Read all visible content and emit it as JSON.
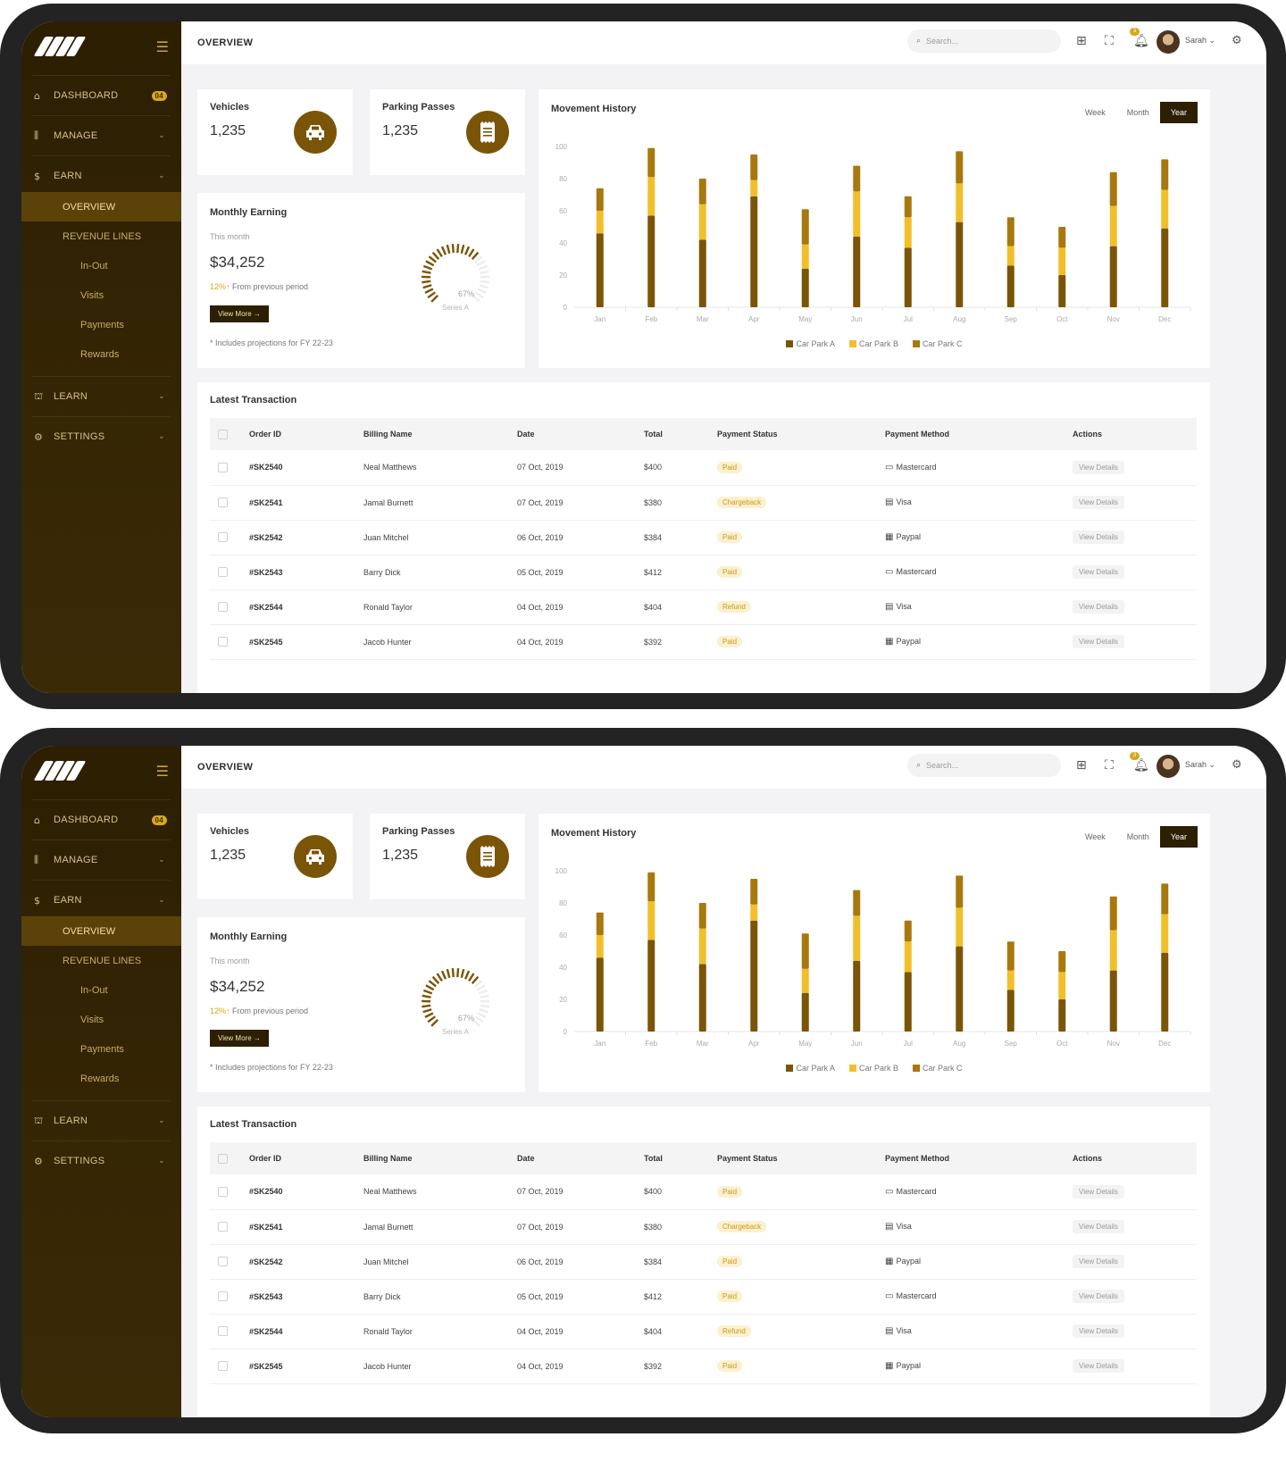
{
  "app": {
    "page_title": "OVERVIEW",
    "search_placeholder": "Search...",
    "user_name": "Sarah",
    "notification_count": "3"
  },
  "sidebar": {
    "dashboard": {
      "label": "DASHBOARD",
      "badge": "04"
    },
    "manage": {
      "label": "MANAGE"
    },
    "earn": {
      "label": "EARN"
    },
    "earn_items": [
      "OVERVIEW",
      "REVENUE LINES"
    ],
    "revenue_items": [
      "In-Out",
      "Visits",
      "Payments",
      "Rewards"
    ],
    "learn": {
      "label": "LEARN"
    },
    "settings": {
      "label": "SETTINGS"
    }
  },
  "stats": {
    "vehicles": {
      "label": "Vehicles",
      "value": "1,235"
    },
    "passes": {
      "label": "Parking Passes",
      "value": "1,235"
    }
  },
  "earning": {
    "title": "Monthly Earning",
    "period": "This month",
    "value": "$34,252",
    "change_pct": "12%",
    "change_arrow": "↑",
    "change_text": "From previous period",
    "button": "View More →",
    "note": "* Includes projections for FY 22-23",
    "gauge_pct": "67%",
    "gauge_series": "Series A",
    "gauge_value": 0.67
  },
  "movement": {
    "title": "Movement History",
    "ranges": [
      "Week",
      "Month",
      "Year"
    ],
    "active_range": "Year"
  },
  "chart_data": {
    "type": "bar",
    "stacked": true,
    "title": "Movement History",
    "categories": [
      "Jan",
      "Feb",
      "Mar",
      "Apr",
      "May",
      "Jun",
      "Jul",
      "Aug",
      "Sep",
      "Oct",
      "Nov",
      "Dec"
    ],
    "series": [
      {
        "name": "Car Park A",
        "color": "#7a5508",
        "values": [
          46,
          57,
          42,
          69,
          24,
          44,
          37,
          53,
          26,
          20,
          38,
          49
        ]
      },
      {
        "name": "Car Park B",
        "color": "#f2bf2a",
        "values": [
          14,
          24,
          22,
          10,
          15,
          28,
          19,
          24,
          12,
          17,
          25,
          24
        ]
      },
      {
        "name": "Car Park C",
        "color": "#a8780e",
        "values": [
          14,
          18,
          16,
          16,
          22,
          16,
          13,
          20,
          18,
          13,
          21,
          19
        ]
      }
    ],
    "yticks": [
      0,
      20,
      40,
      60,
      80,
      100
    ],
    "ylim": [
      0,
      100
    ],
    "legend": "bottom",
    "grid": false
  },
  "transactions": {
    "title": "Latest Transaction",
    "columns": [
      "Order ID",
      "Billing Name",
      "Date",
      "Total",
      "Payment Status",
      "Payment Method",
      "Actions"
    ],
    "action_label": "View Details",
    "rows": [
      {
        "id": "#SK2540",
        "name": "Neal Matthews",
        "date": "07 Oct, 2019",
        "total": "$400",
        "status": "Paid",
        "method": "Mastercard",
        "method_icon": "card"
      },
      {
        "id": "#SK2541",
        "name": "Jamal Burnett",
        "date": "07 Oct, 2019",
        "total": "$380",
        "status": "Chargeback",
        "method": "Visa",
        "method_icon": "visa"
      },
      {
        "id": "#SK2542",
        "name": "Juan Mitchel",
        "date": "06 Oct, 2019",
        "total": "$384",
        "status": "Paid",
        "method": "Paypal",
        "method_icon": "paypal"
      },
      {
        "id": "#SK2543",
        "name": "Barry Dick",
        "date": "05 Oct, 2019",
        "total": "$412",
        "status": "Paid",
        "method": "Mastercard",
        "method_icon": "card"
      },
      {
        "id": "#SK2544",
        "name": "Ronald Taylor",
        "date": "04 Oct, 2019",
        "total": "$404",
        "status": "Refund",
        "method": "Visa",
        "method_icon": "visa"
      },
      {
        "id": "#SK2545",
        "name": "Jacob Hunter",
        "date": "04 Oct, 2019",
        "total": "$392",
        "status": "Paid",
        "method": "Paypal",
        "method_icon": "paypal"
      }
    ]
  },
  "colors": {
    "sidebar": "#2c1f02",
    "accent": "#7a5508",
    "gold": "#f2bf2a",
    "bronze": "#a8780e"
  }
}
